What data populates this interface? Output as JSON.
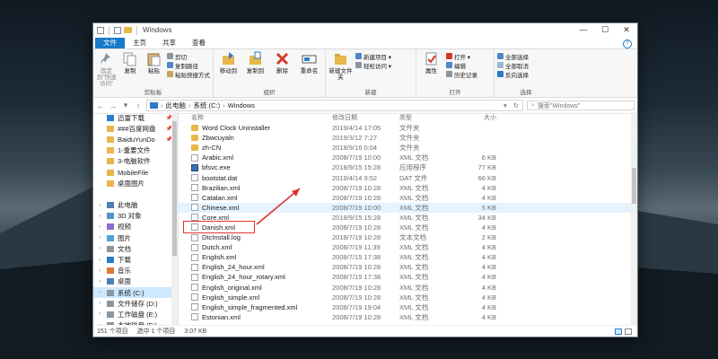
{
  "window": {
    "title": "Windows",
    "controls": [
      "—",
      "☐",
      "✕"
    ]
  },
  "ribbon_tabs": [
    "文件",
    "主页",
    "共享",
    "查看"
  ],
  "ribbon": {
    "clipboard": {
      "pin_label": "固定到\"快速访问\"",
      "copy_label": "复制",
      "paste_label": "粘贴",
      "cut_label": "剪切",
      "copy_path_label": "复制路径",
      "paste_shortcut_label": "粘贴快捷方式",
      "group_label": "剪贴板"
    },
    "organize": {
      "move_label": "移动到",
      "copy_to_label": "复制到",
      "delete_label": "删除",
      "rename_label": "重命名",
      "group_label": "组织"
    },
    "new": {
      "new_folder_label": "新建文件夹",
      "new_item_label": "新建项目 ▾",
      "easy_access_label": "轻松访问 ▾",
      "group_label": "新建"
    },
    "open": {
      "properties_label": "属性",
      "open_label": "打开 ▾",
      "edit_label": "编辑",
      "history_label": "历史记录",
      "group_label": "打开"
    },
    "select": {
      "select_all_label": "全部选择",
      "select_none_label": "全部取消",
      "invert_label": "反向选择",
      "group_label": "选择"
    }
  },
  "address": {
    "back": "←",
    "forward": "→",
    "up_hist": "▾",
    "up": "↑",
    "path": [
      "此电脑",
      "系统 (C:)",
      "Windows"
    ],
    "path_sep": "›",
    "path_dropdown": "▾",
    "refresh": "↻",
    "search_placeholder": "搜索\"Windows\""
  },
  "nav": {
    "items": [
      {
        "label": "迅雷下载",
        "pin": true
      },
      {
        "label": "###百度网盘",
        "pin": true
      },
      {
        "label": "BaiduYunDo",
        "pin": true
      },
      {
        "label": "1-重要文件",
        "pin": false
      },
      {
        "label": "3-电脑软件",
        "pin": false
      },
      {
        "label": "MobileFile",
        "pin": false
      },
      {
        "label": "桌面图片",
        "pin": false
      },
      {
        "label": "",
        "pin": false
      },
      {
        "label": "此电脑",
        "pin": false
      },
      {
        "label": "3D 对象",
        "pin": false
      },
      {
        "label": "视频",
        "pin": false
      },
      {
        "label": "图片",
        "pin": false
      },
      {
        "label": "文档",
        "pin": false
      },
      {
        "label": "下载",
        "pin": false
      },
      {
        "label": "音乐",
        "pin": false
      },
      {
        "label": "桌面",
        "pin": false
      },
      {
        "label": "系统 (C:)",
        "pin": false
      },
      {
        "label": "文件储存 (D:)",
        "pin": false
      },
      {
        "label": "工作磁盘 (E:)",
        "pin": false
      },
      {
        "label": "本地磁盘 (F:)",
        "pin": false
      }
    ]
  },
  "columns": [
    "名称",
    "修改日期",
    "类型",
    "大小"
  ],
  "files": [
    {
      "name": "Word Clock Uninstaller",
      "date": "2019/4/14 17:05",
      "type": "文件夹",
      "size": "",
      "kind": "folder"
    },
    {
      "name": "Zbwcuyaln",
      "date": "2019/3/12 7:27",
      "type": "文件夹",
      "size": "",
      "kind": "folder"
    },
    {
      "name": "zh-CN",
      "date": "2018/9/16 0:04",
      "type": "文件夹",
      "size": "",
      "kind": "folder"
    },
    {
      "name": "Arabic.xml",
      "date": "2008/7/19 10:00",
      "type": "XML 文档",
      "size": "6 KB",
      "kind": "doc"
    },
    {
      "name": "bfsvc.exe",
      "date": "2018/9/15 15:28",
      "type": "应用程序",
      "size": "77 KB",
      "kind": "exe"
    },
    {
      "name": "bootstat.dat",
      "date": "2019/4/14 9:52",
      "type": "DAT 文件",
      "size": "66 KB",
      "kind": "doc"
    },
    {
      "name": "Brazilian.xml",
      "date": "2008/7/19 10:28",
      "type": "XML 文档",
      "size": "4 KB",
      "kind": "doc"
    },
    {
      "name": "Catalan.xml",
      "date": "2008/7/19 10:28",
      "type": "XML 文档",
      "size": "4 KB",
      "kind": "doc"
    },
    {
      "name": "Chinese.xml",
      "date": "2008/7/19 10:00",
      "type": "XML 文档",
      "size": "5 KB",
      "kind": "doc"
    },
    {
      "name": "Core.xml",
      "date": "2018/9/15 15:28",
      "type": "XML 文档",
      "size": "34 KB",
      "kind": "doc"
    },
    {
      "name": "Danish.xml",
      "date": "2008/7/19 10:28",
      "type": "XML 文档",
      "size": "4 KB",
      "kind": "doc"
    },
    {
      "name": "DtcInstall.log",
      "date": "2018/7/19 10:28",
      "type": "文本文档",
      "size": "2 KB",
      "kind": "doc"
    },
    {
      "name": "Dutch.xml",
      "date": "2008/7/19 11:39",
      "type": "XML 文档",
      "size": "4 KB",
      "kind": "doc"
    },
    {
      "name": "English.xml",
      "date": "2008/7/15 17:38",
      "type": "XML 文档",
      "size": "4 KB",
      "kind": "doc"
    },
    {
      "name": "English_24_hour.xml",
      "date": "2008/7/19 10:28",
      "type": "XML 文档",
      "size": "4 KB",
      "kind": "doc"
    },
    {
      "name": "English_24_hour_rotary.xml",
      "date": "2008/7/15 17:38",
      "type": "XML 文档",
      "size": "4 KB",
      "kind": "doc"
    },
    {
      "name": "English_original.xml",
      "date": "2008/7/19 10:28",
      "type": "XML 文档",
      "size": "4 KB",
      "kind": "doc"
    },
    {
      "name": "English_simple.xml",
      "date": "2008/7/19 10:28",
      "type": "XML 文档",
      "size": "4 KB",
      "kind": "doc"
    },
    {
      "name": "English_simple_fragmented.xml",
      "date": "2008/7/19 19:04",
      "type": "XML 文档",
      "size": "4 KB",
      "kind": "doc"
    },
    {
      "name": "Estonian.xml",
      "date": "2008/7/19 10:28",
      "type": "XML 文档",
      "size": "4 KB",
      "kind": "doc"
    }
  ],
  "status": {
    "count": "151 个项目",
    "selected": "选中 1 个项目",
    "size": "3.07 KB"
  },
  "colors": {
    "accent": "#1979ca",
    "highlight_box": "#e0332f",
    "selection": "#cde8ff"
  }
}
